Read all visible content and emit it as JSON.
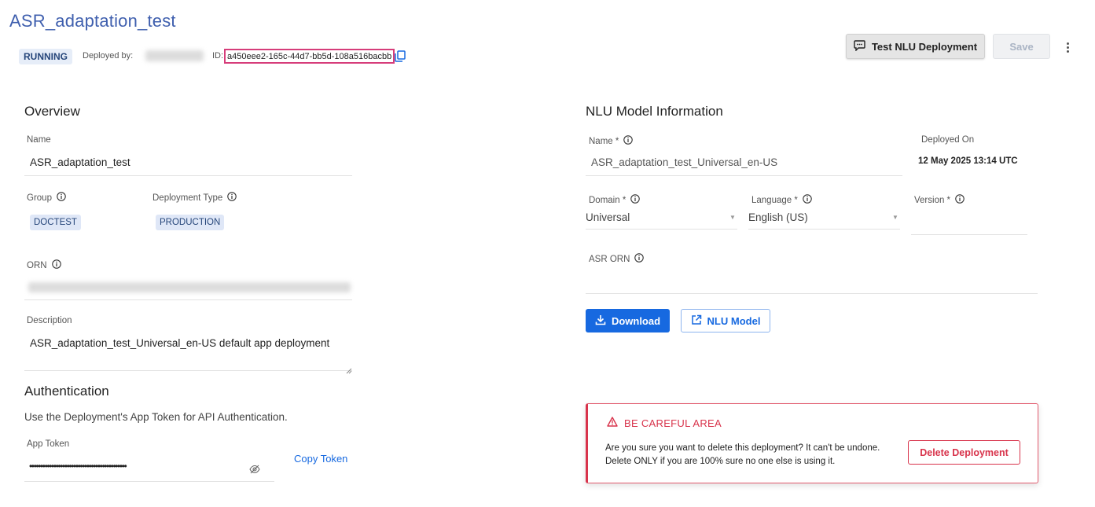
{
  "header": {
    "title": "ASR_adaptation_test",
    "status": "RUNNING",
    "deployed_by_label": "Deployed by:",
    "id_label": "ID:",
    "id_value": "a450eee2-165c-44d7-bb5d-108a516bacbb",
    "test_button_label": "Test NLU Deployment",
    "save_button_label": "Save"
  },
  "overview": {
    "title": "Overview",
    "name_label": "Name",
    "name_value": "ASR_adaptation_test",
    "group_label": "Group",
    "group_value": "DOCTEST",
    "deployment_type_label": "Deployment Type",
    "deployment_type_value": "PRODUCTION",
    "orn_label": "ORN",
    "description_label": "Description",
    "description_value": "ASR_adaptation_test_Universal_en-US default app deployment"
  },
  "authentication": {
    "title": "Authentication",
    "subtitle": "Use the Deployment's App Token for API Authentication.",
    "token_label": "App Token",
    "token_masked": "••••••••••••••••••••••••••••••••••••••••••••",
    "copy_token_label": "Copy Token"
  },
  "nlu": {
    "title": "NLU Model Information",
    "name_label": "Name *",
    "name_value": "ASR_adaptation_test_Universal_en-US",
    "deployed_on_label": "Deployed On",
    "deployed_on_value": "12 May 2025 13:14 UTC",
    "domain_label": "Domain *",
    "domain_value": "Universal",
    "language_label": "Language *",
    "language_value": "English (US)",
    "version_label": "Version *",
    "asr_orn_label": "ASR ORN",
    "download_label": "Download",
    "nlu_model_label": "NLU Model"
  },
  "danger": {
    "title": "BE CAREFUL AREA",
    "message": "Are you sure you want to delete this deployment? It can't be undone. Delete ONLY if you are 100% sure no one else is using it.",
    "delete_label": "Delete Deployment"
  },
  "colors": {
    "brand_title": "#3f5fae",
    "primary": "#1769e0",
    "danger": "#d8334b",
    "chip_bg": "#dfe7f7"
  }
}
